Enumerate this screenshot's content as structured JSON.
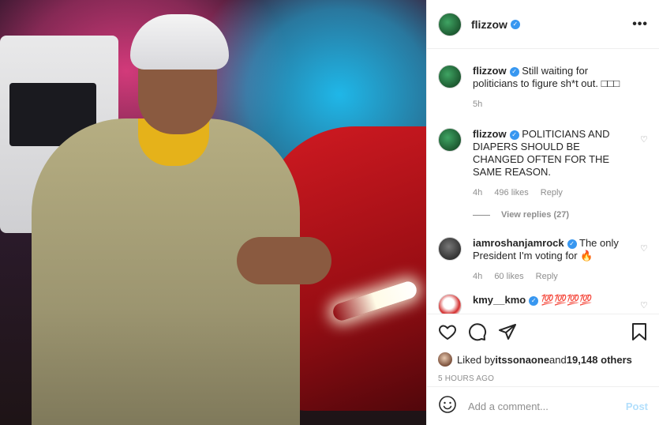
{
  "post": {
    "image_alt": "Man in durag and bomber jacket checking watch in front of red sports car",
    "author": "flizzow"
  },
  "header": {
    "username": "flizzow",
    "more_label": "•••"
  },
  "comments": [
    {
      "username": "flizzow",
      "text": "Still waiting for politicians to figure sh*t out. □□□",
      "time": "5h",
      "verified": true
    },
    {
      "username": "flizzow",
      "text": "POLITICIANS AND DIAPERS SHOULD BE CHANGED OFTEN FOR THE SAME REASON.",
      "time": "4h",
      "likes": "496 likes",
      "reply_label": "Reply",
      "view_replies": "View replies (27)",
      "verified": true
    },
    {
      "username": "iamroshanjamrock",
      "text": "The only President I'm voting for 🔥",
      "time": "4h",
      "likes": "60 likes",
      "reply_label": "Reply",
      "verified": true
    },
    {
      "username": "kmy__kmo",
      "text": "💯💯💯💯",
      "verified": true
    }
  ],
  "actions": {
    "liked_by_prefix": "Liked by ",
    "liked_by_user": "itssonaone",
    "liked_by_and": " and ",
    "liked_by_others": "19,148 others",
    "timestamp": "5 HOURS AGO"
  },
  "add_comment": {
    "placeholder": "Add a comment...",
    "post_label": "Post"
  },
  "colors": {
    "verified_blue": "#3897f0",
    "post_button_disabled": "#b2dffc",
    "muted_text": "#8e8e8e"
  },
  "icons": [
    "more-icon",
    "heart-icon",
    "comment-icon",
    "share-icon",
    "bookmark-icon",
    "emoji-icon",
    "verified-icon"
  ]
}
